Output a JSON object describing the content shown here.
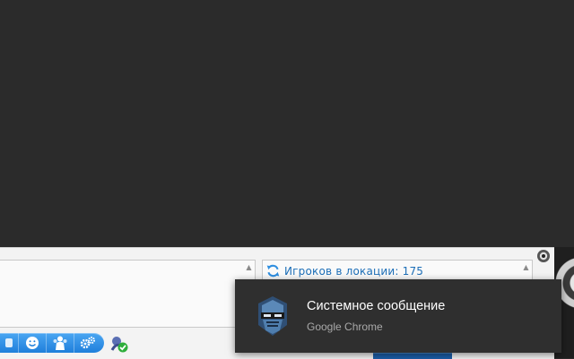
{
  "players_panel": {
    "label": "Игроков в локации: 175",
    "icon": "refresh-icon",
    "scroll_icon": "scroll-up-arrow-icon"
  },
  "chat_panel": {
    "scroll_icon": "scroll-up-arrow-icon"
  },
  "toolbar": {
    "buttons": [
      {
        "icon": "tab-partial-icon"
      },
      {
        "icon": "smiley-icon"
      },
      {
        "icon": "users-icon"
      },
      {
        "icon": "settings-gears-icon"
      }
    ],
    "status_icon": "online-status-check-icon"
  },
  "notification": {
    "title": "Системное сообщение",
    "source": "Google Chrome",
    "icon": "robot-mask-icon"
  },
  "colors": {
    "background": "#2b2b2b",
    "panel": "#f3f3f3",
    "accent_blue": "#1f7fdb",
    "link_text": "#1d6fb8",
    "toast_bg": "#2f2f2f"
  }
}
